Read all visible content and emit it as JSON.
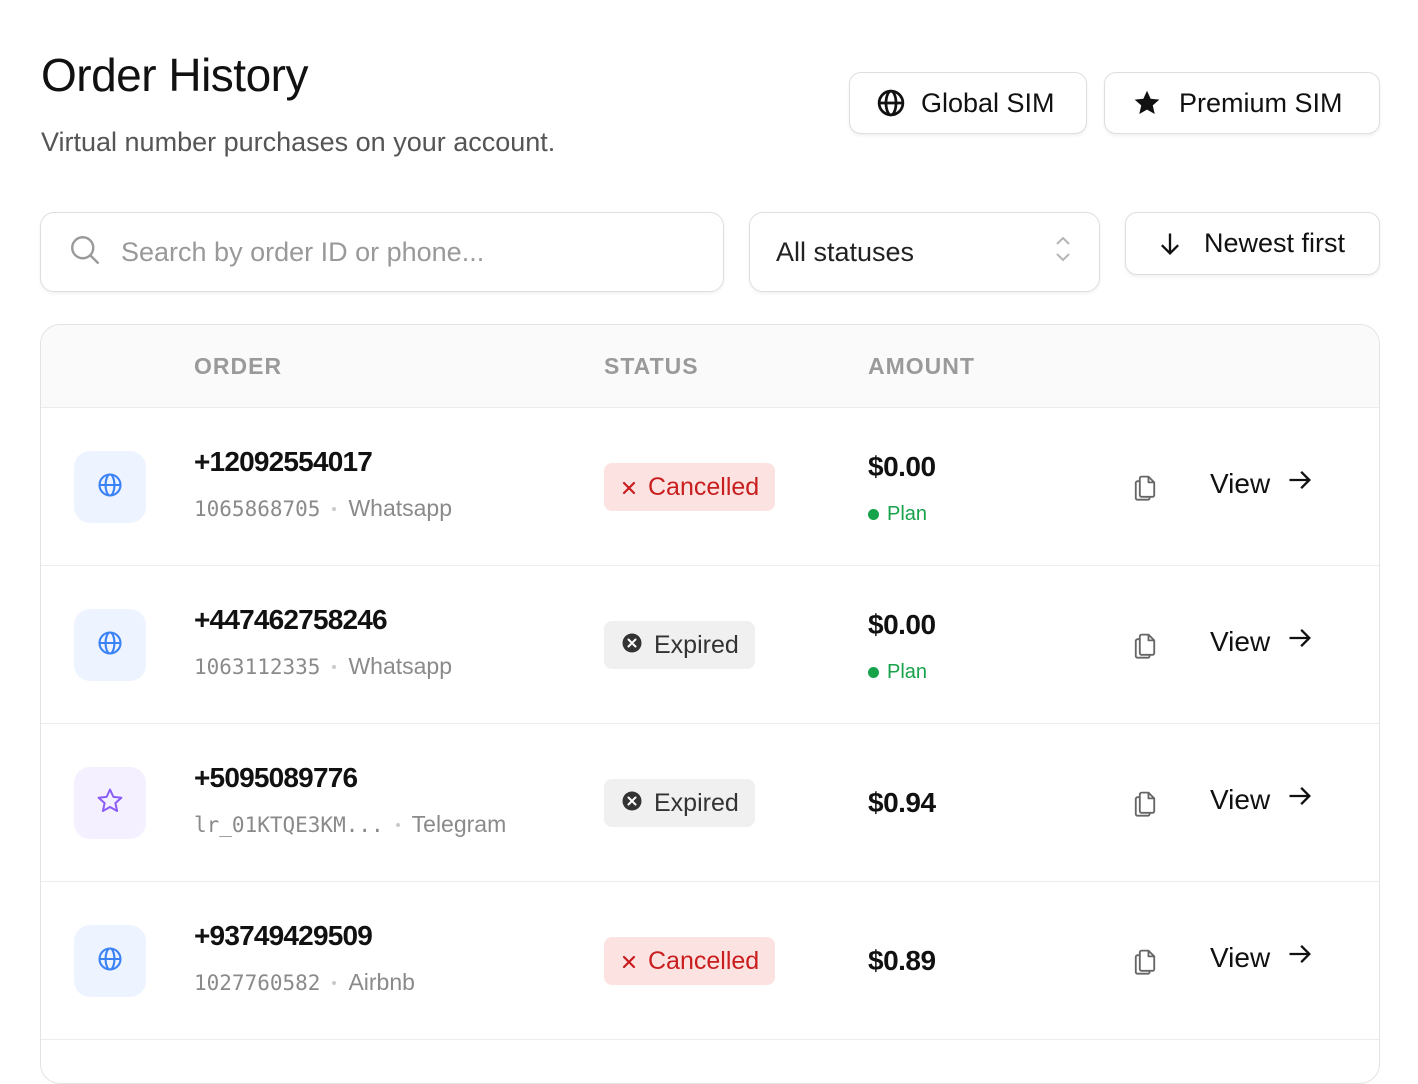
{
  "header": {
    "title": "Order History",
    "subtitle": "Virtual number purchases on your account.",
    "buttons": {
      "global": {
        "label": "Global SIM",
        "icon": "globe-icon"
      },
      "premium": {
        "label": "Premium SIM",
        "icon": "star-icon"
      }
    }
  },
  "filters": {
    "search_placeholder": "Search by order ID or phone...",
    "status_selected": "All statuses",
    "sort_label": "Newest first"
  },
  "table": {
    "columns": [
      "ORDER",
      "STATUS",
      "AMOUNT"
    ],
    "action_label": "View",
    "rows": [
      {
        "icon": "globe-icon",
        "phone": "+12092554017",
        "order_id": "1065868705",
        "service": "Whatsapp",
        "status": "Cancelled",
        "status_type": "cancelled",
        "amount": "$0.00",
        "plan": "Plan"
      },
      {
        "icon": "globe-icon",
        "phone": "+447462758246",
        "order_id": "1063112335",
        "service": "Whatsapp",
        "status": "Expired",
        "status_type": "expired",
        "amount": "$0.00",
        "plan": "Plan"
      },
      {
        "icon": "star-icon",
        "phone": "+5095089776",
        "order_id": "lr_01KTQE3KM...",
        "service": "Telegram",
        "status": "Expired",
        "status_type": "expired",
        "amount": "$0.94",
        "plan": null
      },
      {
        "icon": "globe-icon",
        "phone": "+93749429509",
        "order_id": "1027760582",
        "service": "Airbnb",
        "status": "Cancelled",
        "status_type": "cancelled",
        "amount": "$0.89",
        "plan": null
      }
    ]
  },
  "colors": {
    "cancelled_bg": "#fde2e2",
    "cancelled_text": "#c81e1e",
    "expired_bg": "#f0f0f0",
    "plan_green": "#16a34a",
    "globe_blue": "#3b82f6",
    "star_purple": "#8b5cf6"
  }
}
